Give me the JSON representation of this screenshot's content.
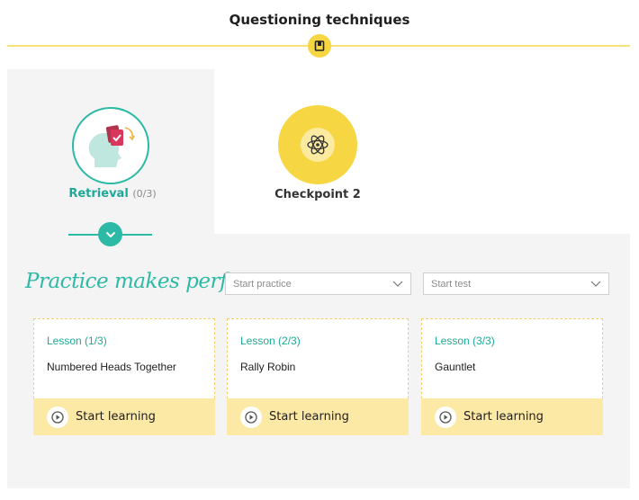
{
  "header": {
    "title": "Questioning techniques",
    "badge_icon": "book-icon"
  },
  "path": {
    "nodes": [
      {
        "label": "Retrieval",
        "count": "(0/3)",
        "icon": "head-with-cards-icon",
        "state": "current"
      },
      {
        "label": "Checkpoint 2",
        "icon": "atom-icon",
        "state": "locked"
      }
    ]
  },
  "practice": {
    "title": "Practice makes perfect:",
    "practice_dropdown": "Start practice",
    "test_dropdown": "Start test"
  },
  "lessons": [
    {
      "lesson": "Lesson (1/3)",
      "name": "Numbered Heads Together",
      "action": "Start learning"
    },
    {
      "lesson": "Lesson (2/3)",
      "name": "Rally Robin",
      "action": "Start learning"
    },
    {
      "lesson": "Lesson (3/3)",
      "name": "Gauntlet",
      "action": "Start learning"
    }
  ],
  "colors": {
    "teal": "#2cb9a5",
    "yellow": "#f6d743",
    "card_footer": "#fde9a6"
  }
}
